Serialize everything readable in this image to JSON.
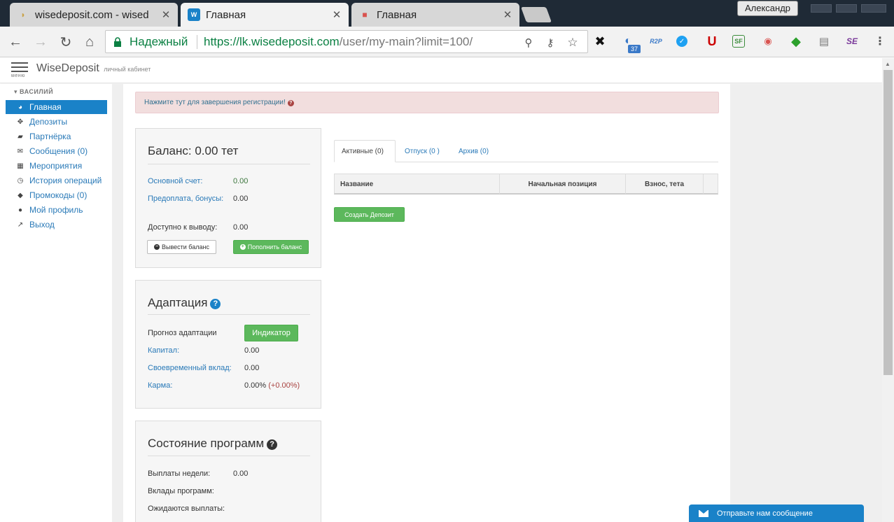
{
  "browser": {
    "tabs": [
      {
        "title": "wisedeposit.com - wised",
        "active": false
      },
      {
        "title": "Главная",
        "active": true
      },
      {
        "title": "Главная",
        "active": false
      }
    ],
    "user": "Александр",
    "secure_label": "Надежный",
    "url_host": "https://lk.wisedeposit.com",
    "url_path": "/user/my-main?limit=100/",
    "extension_badge": "37"
  },
  "header": {
    "menu_label": "меню",
    "brand": "WiseDeposit",
    "brand_sub": "личный кабинет"
  },
  "sidebar": {
    "user": "ВАСИЛИЙ",
    "items": [
      {
        "label": "Главная",
        "icon": "dashboard-icon",
        "active": true
      },
      {
        "label": "Депозиты",
        "icon": "crosshair-icon",
        "active": false
      },
      {
        "label": "Партнёрка",
        "icon": "briefcase-icon",
        "active": false
      },
      {
        "label": "Сообщения (0)",
        "icon": "envelope-icon",
        "active": false
      },
      {
        "label": "Мероприятия",
        "icon": "film-icon",
        "active": false
      },
      {
        "label": "История операций",
        "icon": "clock-icon",
        "active": false
      },
      {
        "label": "Промокоды (0)",
        "icon": "tag-icon",
        "active": false
      },
      {
        "label": "Мой профиль",
        "icon": "user-icon",
        "active": false
      },
      {
        "label": "Выход",
        "icon": "logout-icon",
        "active": false
      }
    ]
  },
  "alert": {
    "text": "Нажмите тут для завершения регистрации!"
  },
  "balance": {
    "title": "Баланс: 0.00 тет",
    "main_label": "Основной счет:",
    "main_value": "0.00",
    "prepay_label": "Предоплата, бонусы:",
    "prepay_value": "0.00",
    "available_label": "Доступно к выводу:",
    "available_value": "0.00",
    "withdraw_button": "Вывести баланс",
    "topup_button": "Пополнить баланс"
  },
  "adaptation": {
    "title": "Адаптация",
    "forecast_label": "Прогноз адаптации",
    "indicator_button": "Индикатор",
    "capital_label": "Капитал:",
    "capital_value": "0.00",
    "timely_label": "Своевременный вклад:",
    "timely_value": "0.00",
    "karma_label": "Карма:",
    "karma_value": "0.00%",
    "karma_delta": "(+0.00%)"
  },
  "programs": {
    "title": "Состояние программ",
    "weekly_label": "Выплаты недели:",
    "weekly_value": "0.00",
    "deposits_label": "Вклады программ:",
    "awaiting_label": "Ожидаются выплаты:"
  },
  "deposits": {
    "tabs": [
      "Активные (0)",
      "Отпуск (0 )",
      "Архив (0)"
    ],
    "columns": [
      "Название",
      "Начальная позиция",
      "Взнос, тета"
    ],
    "create_button": "Создать Депозит"
  },
  "chat": {
    "label": "Отправьте нам сообщение"
  },
  "colors": {
    "accent": "#1a82c8",
    "success": "#5cb85c",
    "alert_bg": "#f2dede",
    "secure_green": "#0b8043"
  }
}
